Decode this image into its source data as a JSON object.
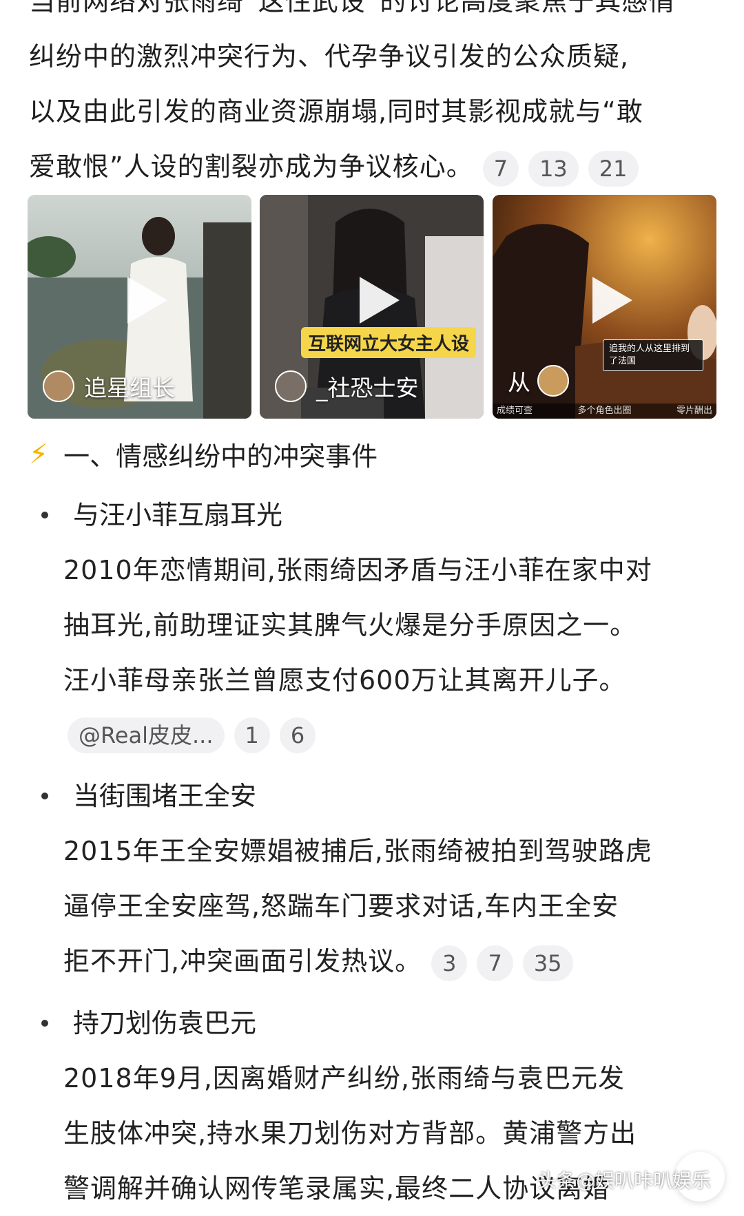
{
  "intro": {
    "lines": [
      "当前网络对张雨绮“这性武设”的讨论高度聚焦于其感情",
      "纠纷中的激烈冲突行为、代孕争议引发的公众质疑,",
      "以及由此引发的商业资源崩塌,同时其影视成就与“敢",
      "爱敢恨”人设的割裂亦成为争议核心。"
    ],
    "refs": [
      "7",
      "13",
      "21"
    ]
  },
  "videos": [
    {
      "author": "追星组长",
      "overlay": ""
    },
    {
      "author": "_社恐士安",
      "overlay": "互联网立大女主人设"
    },
    {
      "author": "从",
      "overlay": "追我的人从这里排到了法国",
      "captions": [
        "成绩可查",
        "多个角色出圈",
        "零片酬出"
      ]
    }
  ],
  "section": {
    "icon": "lightning-icon",
    "title": "一、情感纠纷中的冲突事件"
  },
  "items": [
    {
      "title": "与汪小菲互扇耳光",
      "lines": [
        "2010年恋情期间,张雨绮因矛盾与汪小菲在家中对",
        "抽耳光,前助理证实其脾气火爆是分手原因之一。",
        "汪小菲母亲张兰曾愿支付600万让其离开儿子。"
      ],
      "chips": [
        "@Real皮皮...",
        "1",
        "6"
      ]
    },
    {
      "title": "当街围堵王全安",
      "lines": [
        "2015年王全安嫖娼被捕后,张雨绮被拍到驾驶路虎",
        "逼停王全安座驾,怒踹车门要求对话,车内王全安",
        "拒不开门,冲突画面引发热议。"
      ],
      "inline_refs": [
        "3",
        "7",
        "35"
      ]
    },
    {
      "title": "持刀划伤袁巴元",
      "lines": [
        "2018年9月,因离婚财产纠纷,张雨绮与袁巴元发",
        "生肢体冲突,持水果刀划伤对方背部。黄浦警方出",
        "警调解并确认网传笔录属实,最终二人协议离婚"
      ]
    }
  ],
  "watermark": "头条@娱叭咔叭娱乐"
}
